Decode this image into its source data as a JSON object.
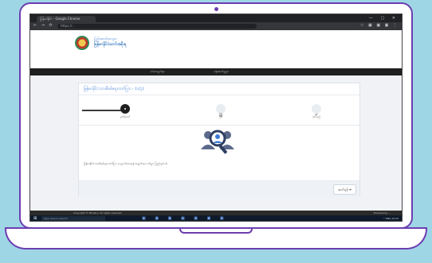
{
  "colors": {
    "background": "#9fd6e6",
    "laptop_outline": "#6c3eb1",
    "accent": "#3a7bd5",
    "menubar": "#1f1f1f"
  },
  "browser": {
    "tab_title": "မြန်မာနိုင်ငံ - Google Chrome",
    "url": "https://...",
    "nav_icons": "← → ⟳",
    "window_controls": "— ▢ ✕",
    "extension_icons": "☆ ▣ ▣ ▣ ⋮"
  },
  "header": {
    "site_title_line1": "ပြည်ထောင်စုသမ္မတ",
    "site_title_line2": "မြန်မာနိုင်ငံတော်အစိုးရ",
    "menu": [
      "ပင်မစာမျက်နှာ",
      "ဝန်ဆောင်မှုများ"
    ]
  },
  "card": {
    "title": "မြန်မာနိုင်ငံသားစိစစ်ရေးကတ်ပြား - (၁/၃)",
    "steps": [
      {
        "label": "မှတ်ပုံတင်",
        "icon": ""
      },
      {
        "label": "ပုံစံ",
        "icon": "▤"
      },
      {
        "label": "အတည်",
        "icon": "✔"
      }
    ],
    "description": "မြန်မာနိုင်ငံသားစိစစ်ရေးကတ်ပြား လျှောက်ထားရန် အချက်အလက်များ ဖြည့်သွင်းပါ။",
    "next_button": "ဆက်ရန် ➔"
  },
  "footer": {
    "left": "Copyright © Ministry. All rights reserved.",
    "right": "Powered by ..."
  },
  "taskbar": {
    "start": "⊞",
    "search": "Type here to search",
    "apps": "▣ ▣ ▣ ▣ ▣ ▣ ▣",
    "tray": "^ ENG 10:25"
  }
}
